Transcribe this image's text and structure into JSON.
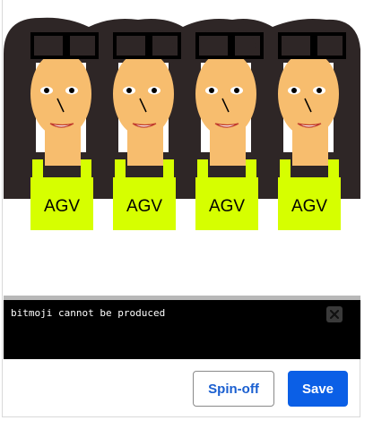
{
  "avatar_panel": {
    "avatars": [
      {
        "shirt_text": "AGV"
      },
      {
        "shirt_text": "AGV"
      },
      {
        "shirt_text": "AGV"
      },
      {
        "shirt_text": "AGV"
      }
    ],
    "colors": {
      "hair": "#2e2626",
      "skin": "#f7bd6e",
      "shirt": "#d6ff00",
      "glasses": "#000000"
    }
  },
  "console": {
    "message": "bitmoji cannot be produced",
    "close_icon": "close-x-icon"
  },
  "actions": {
    "secondary_label": "Spin-off",
    "primary_label": "Save",
    "primary_color": "#0b5fe6"
  }
}
